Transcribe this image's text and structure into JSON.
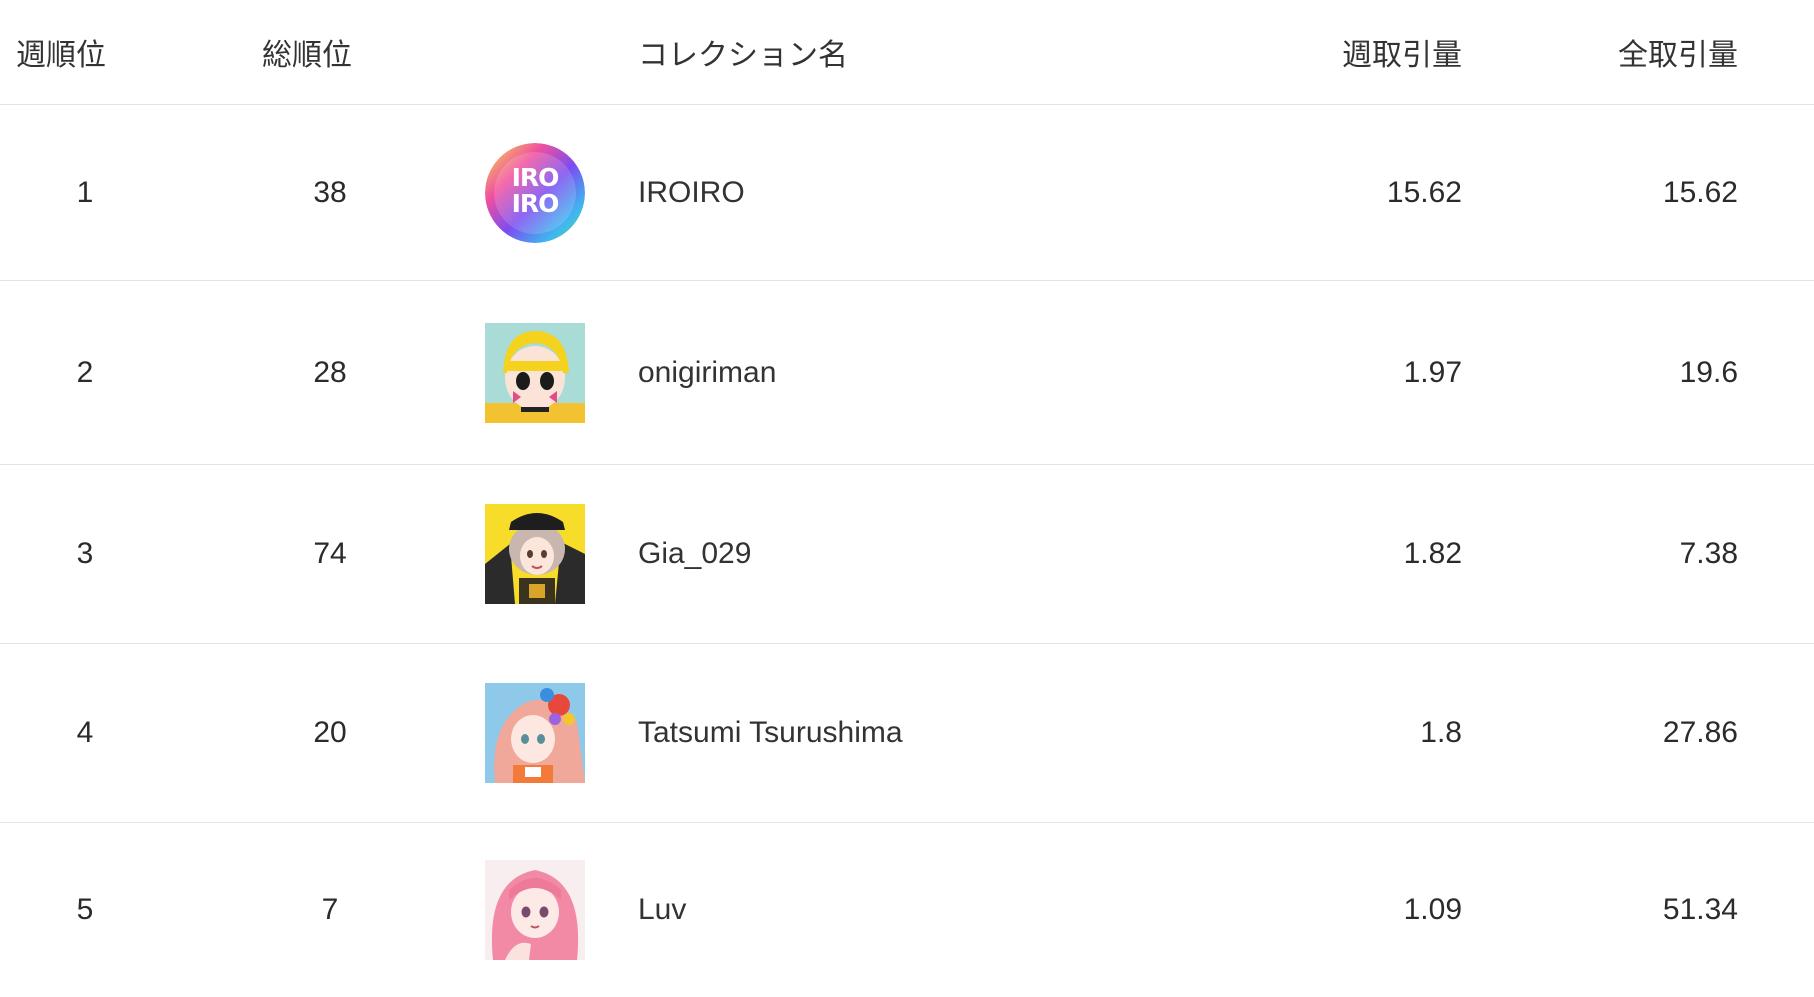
{
  "columns": {
    "week_rank": "週順位",
    "total_rank": "総順位",
    "collection_name": "コレクション名",
    "weekly_volume": "週取引量",
    "total_volume": "全取引量"
  },
  "rows": [
    {
      "week_rank": "1",
      "total_rank": "38",
      "name": "IROIRO",
      "weekly_volume": "15.62",
      "total_volume": "15.62",
      "logo_text": "IRO IRO"
    },
    {
      "week_rank": "2",
      "total_rank": "28",
      "name": "onigiriman",
      "weekly_volume": "1.97",
      "total_volume": "19.6"
    },
    {
      "week_rank": "3",
      "total_rank": "74",
      "name": "Gia_029",
      "weekly_volume": "1.82",
      "total_volume": "7.38"
    },
    {
      "week_rank": "4",
      "total_rank": "20",
      "name": "Tatsumi Tsurushima",
      "weekly_volume": "1.8",
      "total_volume": "27.86"
    },
    {
      "week_rank": "5",
      "total_rank": "7",
      "name": "Luv",
      "weekly_volume": "1.09",
      "total_volume": "51.34"
    }
  ],
  "colors": {
    "text": "#2b2b2b",
    "divider": "#e3e3e3",
    "background": "#ffffff"
  }
}
